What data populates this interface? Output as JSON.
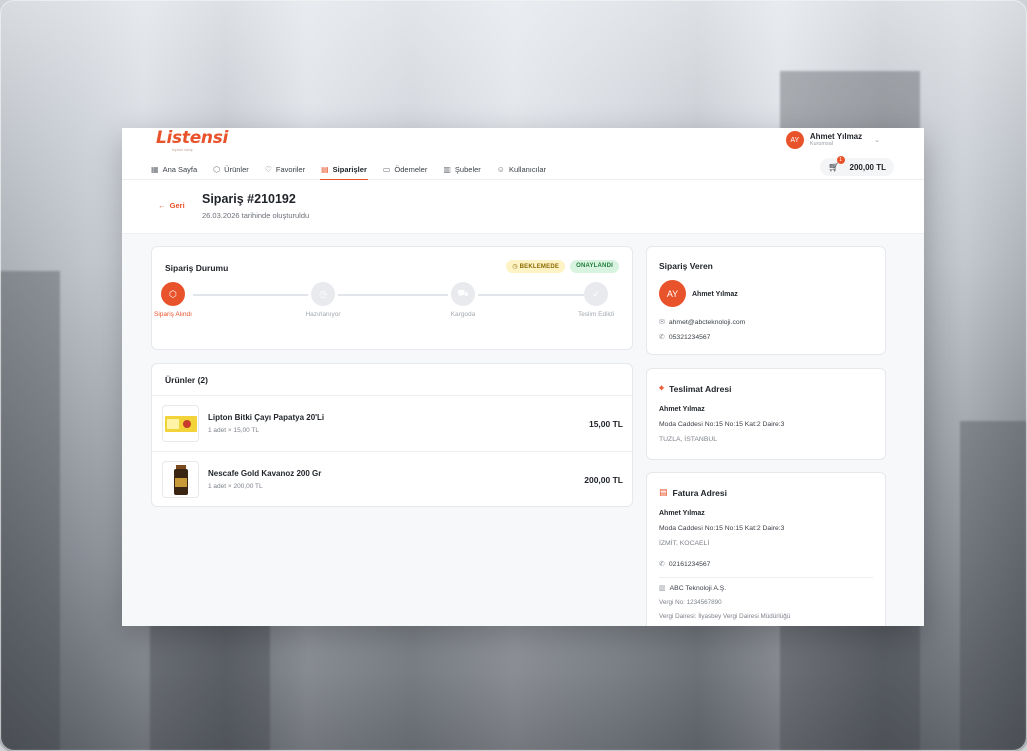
{
  "brand": {
    "logo": "Listensi",
    "tagline": "toptan satış"
  },
  "user": {
    "initials": "AY",
    "name": "Ahmet Yılmaz",
    "role": "Kurumsal"
  },
  "nav": [
    {
      "label": "Ana Sayfa",
      "icon": "grid-icon"
    },
    {
      "label": "Ürünler",
      "icon": "box-icon"
    },
    {
      "label": "Favoriler",
      "icon": "heart-icon"
    },
    {
      "label": "Siparişler",
      "icon": "clipboard-icon",
      "active": true
    },
    {
      "label": "Ödemeler",
      "icon": "card-icon"
    },
    {
      "label": "Şubeler",
      "icon": "building-icon"
    },
    {
      "label": "Kullanıcılar",
      "icon": "users-icon"
    }
  ],
  "cart": {
    "count": "1",
    "total": "200,00 TL"
  },
  "page": {
    "back_label": "Geri",
    "title": "Sipariş #210192",
    "subtitle": "26.03.2026 tarihinde oluşturuldu"
  },
  "status": {
    "title": "Sipariş Durumu",
    "badge_pending": "BEKLEMEDE",
    "badge_approved": "ONAYLANDI",
    "steps": [
      {
        "label": "Sipariş Alındı",
        "done": true
      },
      {
        "label": "Hazırlanıyor",
        "done": false
      },
      {
        "label": "Kargoda",
        "done": false
      },
      {
        "label": "Teslim Edildi",
        "done": false
      }
    ]
  },
  "products": {
    "title": "Ürünler (2)",
    "items": [
      {
        "name": "Lipton Bitki Çayı Papatya 20'Li",
        "meta": "1 adet × 15,00 TL",
        "price": "15,00 TL"
      },
      {
        "name": "Nescafe Gold Kavanoz 200 Gr",
        "meta": "1 adet × 200,00 TL",
        "price": "200,00 TL"
      }
    ]
  },
  "orderer": {
    "title": "Sipariş Veren",
    "initials": "AY",
    "name": "Ahmet Yılmaz",
    "email": "ahmet@abcteknoloji.com",
    "phone": "05321234567"
  },
  "shipping": {
    "title": "Teslimat Adresi",
    "name": "Ahmet Yılmaz",
    "address": "Moda Caddesi No:15 No:15 Kat:2 Daire:3",
    "city": "TUZLA, İSTANBUL"
  },
  "billing": {
    "title": "Fatura Adresi",
    "name": "Ahmet Yılmaz",
    "address": "Moda Caddesi No:15 No:15 Kat:2 Daire:3",
    "city": "İZMİT, KOCAELİ",
    "phone": "02161234567",
    "company": "ABC Teknoloji A.Ş.",
    "tax_no": "Vergi No: 1234567890",
    "tax_office": "Vergi Dairesi: İlyasbey Vergi Dairesi Müdürlüğü"
  }
}
